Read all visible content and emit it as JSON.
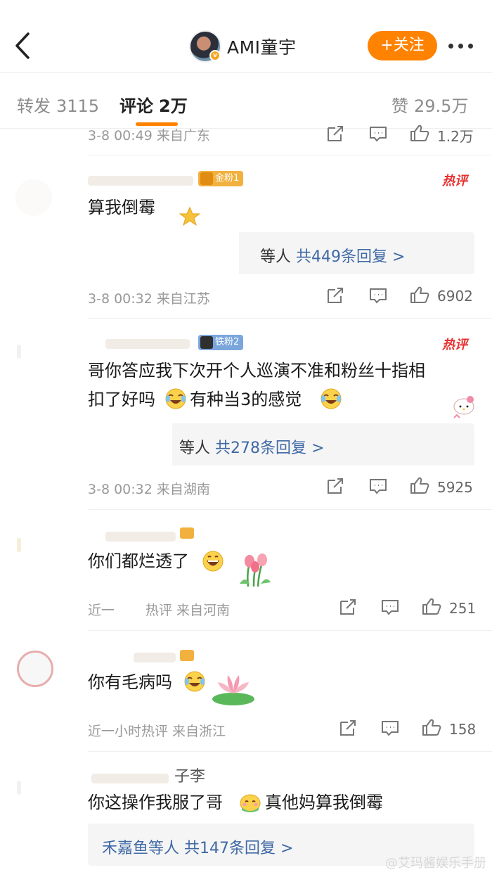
{
  "header": {
    "username": "AMI童宇",
    "follow_label": "+关注"
  },
  "tabs": {
    "repost_label": "转发",
    "repost_count": "3115",
    "comment_label": "评论",
    "comment_count": "2万",
    "like_label": "赞",
    "like_count": "29.5万"
  },
  "comments": [
    {
      "meta": "3-8 00:49 来自广东",
      "likes": "1.2万"
    },
    {
      "badge": "金粉1",
      "hot": "热评",
      "text": "算我倒霉",
      "reply_names": "等人",
      "reply_link": "共449条回复 >",
      "meta": "3-8 00:32 来自江苏",
      "likes": "6902"
    },
    {
      "badge": "铁粉2",
      "hot": "热评",
      "text_line1": "哥你答应我下次开个人巡演不准和粉丝十指相",
      "text_line2a": "扣了好吗",
      "text_line2b": "有种当3的感觉",
      "reply_names": "等人",
      "reply_link": "共278条回复 >",
      "meta": "3-8 00:32 来自湖南",
      "likes": "5925"
    },
    {
      "text": "你们都烂透了",
      "meta_a": "近一",
      "meta_b": "热评 来自河南",
      "likes": "251"
    },
    {
      "text": "你有毛病吗",
      "meta": "近一小时热评 来自浙江",
      "likes": "158"
    },
    {
      "name_tail": "子李",
      "text_a": "你这操作我服了哥",
      "text_b": "真他妈算我倒霉",
      "reply_names": "禾嘉鱼等人",
      "reply_link": "共147条回复 >"
    }
  ],
  "watermark": "@艾玛酱娱乐手册",
  "colors": {
    "accent": "#ff8200",
    "link": "#3f69a6",
    "hot": "#e8302f"
  }
}
